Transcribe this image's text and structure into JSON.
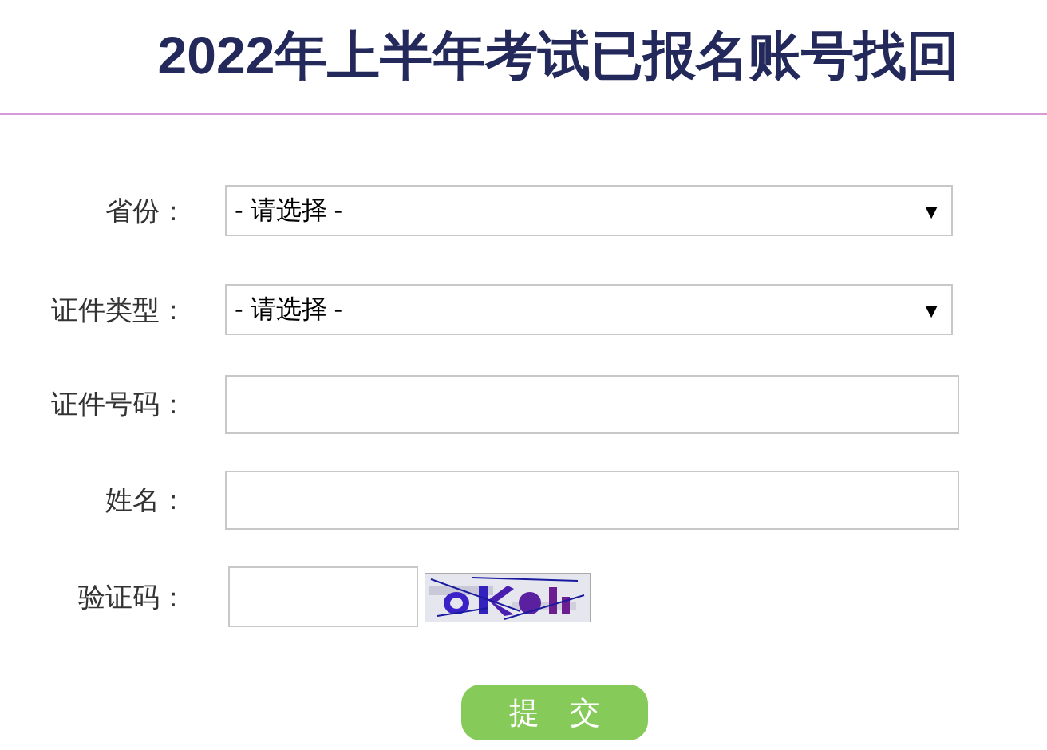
{
  "title": "2022年上半年考试已报名账号找回",
  "fields": [
    {
      "kind": "select",
      "label": "省份：",
      "value": "- 请选择 -",
      "arrow": "▼"
    },
    {
      "kind": "select",
      "label": "证件类型：",
      "value": "- 请选择 -",
      "arrow": "▼"
    },
    {
      "kind": "input",
      "label": "证件号码："
    },
    {
      "kind": "input",
      "label": "姓名："
    },
    {
      "kind": "captcha",
      "label": "验证码："
    }
  ],
  "submit": "提　交"
}
